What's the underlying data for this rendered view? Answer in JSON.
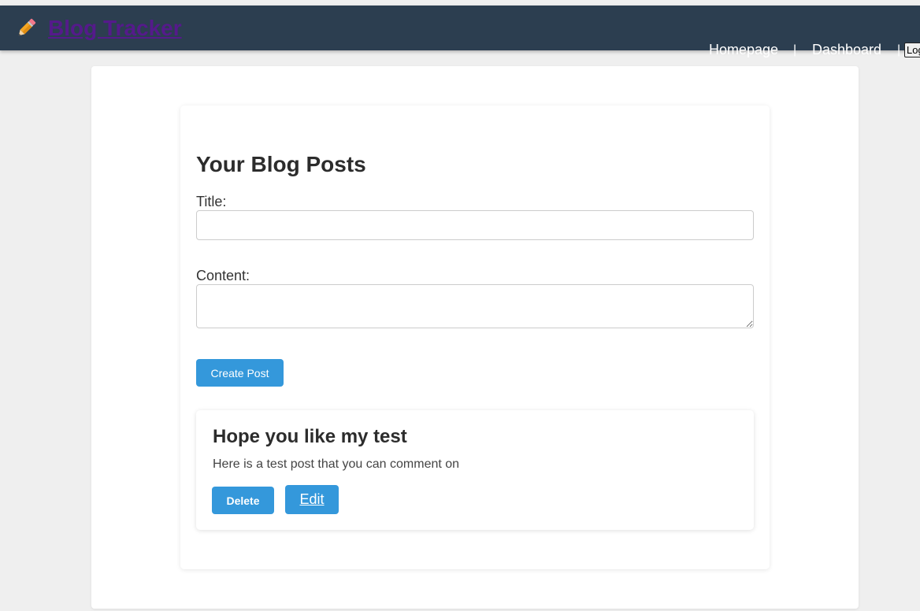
{
  "header": {
    "brand": "Blog Tracker",
    "brand_icon": "pencil-icon",
    "nav": {
      "homepage": "Homepage",
      "separator": "|",
      "dashboard": "Dashboard",
      "logout": "Logout"
    }
  },
  "main": {
    "heading": "Your Blog Posts",
    "form": {
      "title_label": "Title:",
      "title_value": "",
      "content_label": "Content:",
      "content_value": "",
      "submit": "Create Post"
    },
    "posts": [
      {
        "title": "Hope you like my test",
        "content": "Here is a test post that you can comment on",
        "delete_label": "Delete",
        "edit_label": "Edit"
      }
    ]
  },
  "colors": {
    "header_bg": "#2c3e50",
    "accent": "#3498db",
    "brand_link": "#551a8b",
    "page_bg": "#efefef"
  }
}
